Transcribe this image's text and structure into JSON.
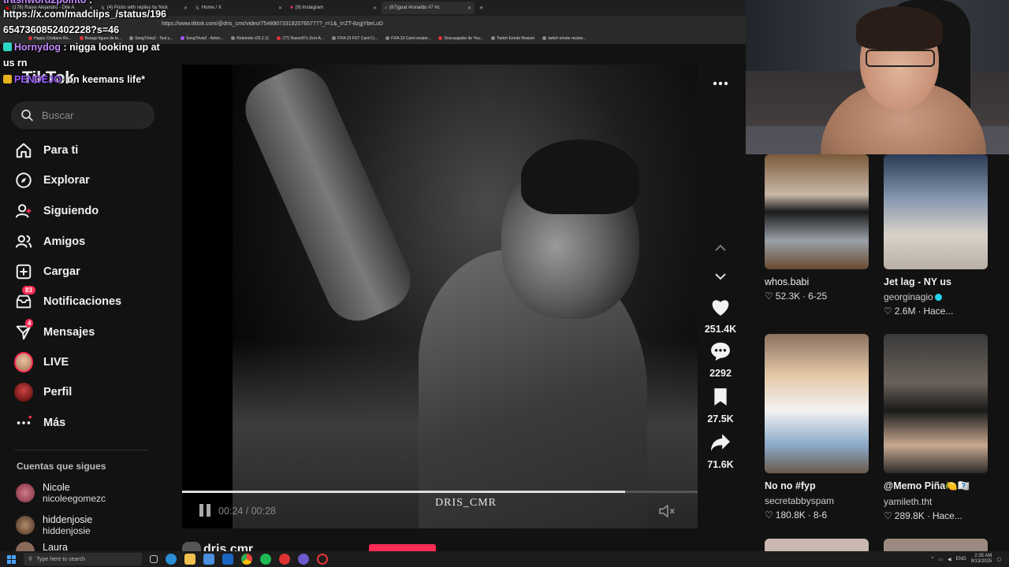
{
  "browser": {
    "tabs": [
      {
        "label": "(178) Rauw Alejandro - Dile A",
        "icon_color": "#ff0000",
        "active": false
      },
      {
        "label": "(4) Posts with replies by Nick",
        "icon_color": "#ffffff",
        "active": false
      },
      {
        "label": "Home / X",
        "icon_color": "#ffffff",
        "active": false
      },
      {
        "label": "(9) Instagram",
        "icon_color": "#e1306c",
        "active": false
      },
      {
        "label": "(87)goat #ronaldo #7 #c",
        "icon_color": "#ffffff",
        "active": true
      }
    ],
    "new_tab": "+",
    "url": "https://www.tiktok.com/@dris_cmr/video/7548907331920765777?_r=1&_t=ZT-8zgjYbeLoD",
    "bookmarks": [
      "Happy Cristiano Ro...",
      "Burago figura de to...",
      "SongTrivia2 - Test y...",
      "SongTrivia2 - Advin...",
      "Reletools v25.1.11",
      "(77) Razzo97x Zest-A...",
      "FIFA 23 FUT Card Cr...",
      "FIFA 23 Card creator...",
      "Descargador de You...",
      "Twitch Emote Resizer",
      "twitch emote resizer..."
    ]
  },
  "chat": {
    "line1_user": "trashword2pointo",
    "line1_rest": " :",
    "line2": "https://x.com/madclips_/status/196",
    "line3": "6547360852402228?s=46",
    "line4_user": "Hornydog",
    "line4_text": " : nigga looking up at",
    "line5": "us rn",
    "line6_user": "PENDEJO",
    "line6_text": ": on keemans life*"
  },
  "sidebar": {
    "logo": "TikTok",
    "search_placeholder": "Buscar",
    "nav": [
      {
        "label": "Para ti",
        "icon": "home-icon"
      },
      {
        "label": "Explorar",
        "icon": "compass-icon"
      },
      {
        "label": "Siguiendo",
        "icon": "following-icon"
      },
      {
        "label": "Amigos",
        "icon": "friends-icon"
      },
      {
        "label": "Cargar",
        "icon": "upload-icon"
      },
      {
        "label": "Notificaciones",
        "icon": "inbox-icon",
        "badge": "83"
      },
      {
        "label": "Mensajes",
        "icon": "messages-icon",
        "badge": "4"
      },
      {
        "label": "LIVE",
        "icon": "live-avatar"
      },
      {
        "label": "Perfil",
        "icon": "profile-avatar"
      },
      {
        "label": "Más",
        "icon": "more-icon"
      }
    ],
    "following_title": "Cuentas que sigues",
    "accounts": [
      {
        "name": "Nicole",
        "handle": "nicoleegomezc"
      },
      {
        "name": "hiddenjosie",
        "handle": "hiddenjosie"
      },
      {
        "name": "Laura",
        "handle": ""
      }
    ]
  },
  "video": {
    "watermark": "DRIS_CMR",
    "time": "00:24 / 00:28",
    "progress": 0.86,
    "author": "dris.cmr"
  },
  "actions": {
    "likes": "251.4K",
    "comments": "2292",
    "saves": "27.5K",
    "shares": "71.6K"
  },
  "feed": [
    {
      "title": "whos.babi",
      "user": "",
      "likes": "52.3K",
      "date": "6-25",
      "bold": false
    },
    {
      "title": "Jet lag - NY us",
      "user": "georginagio",
      "likes": "2.6M",
      "date": "Hace...",
      "bold": true,
      "verified": true
    },
    {
      "title": "No no #fyp",
      "user": "secretabbyspam",
      "likes": "180.8K",
      "date": "8-6",
      "bold": true
    },
    {
      "title": "@Memo Piña🍋🇽🇽",
      "user": "yamileth.tht",
      "likes": "289.8K",
      "date": "Hace...",
      "bold": true
    }
  ],
  "taskbar": {
    "search_placeholder": "Type here to search",
    "time": "2:35 AM",
    "date": "9/13/2025",
    "lang": "ENG"
  }
}
